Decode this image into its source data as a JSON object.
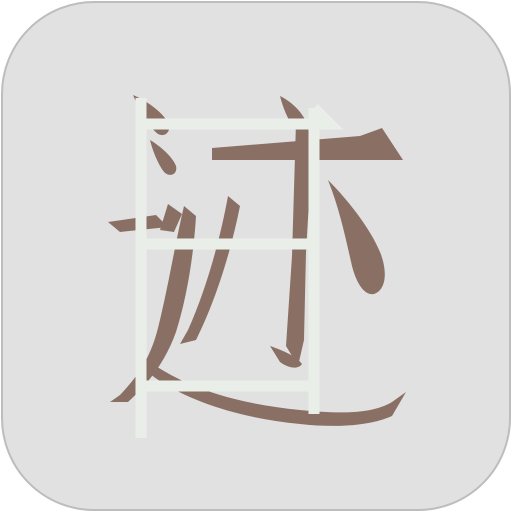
{
  "app_icon": {
    "glyph": "迹",
    "colors": {
      "tile_background": "#e1e1e1",
      "tile_border": "#bdbdbd",
      "glyph": "#8a7064",
      "frame_overlay": "#e9efe8"
    },
    "icon_names": [
      "app-icon",
      "character-glyph-icon",
      "frame-overlay-icon"
    ]
  }
}
